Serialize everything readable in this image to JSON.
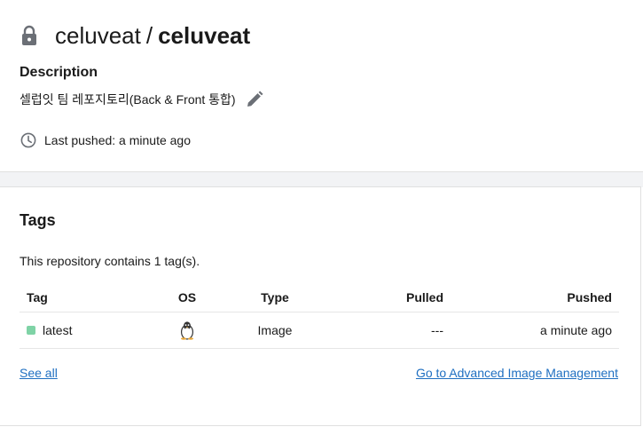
{
  "repo": {
    "namespace": "celuveat",
    "separator": "/",
    "name": "celuveat",
    "lock_icon": "lock-icon"
  },
  "description": {
    "label": "Description",
    "text": "셀럽잇 팀 레포지토리(Back & Front 통합)",
    "edit_icon": "pencil-icon"
  },
  "last_pushed": {
    "icon": "clock-icon",
    "text": "Last pushed: a minute ago"
  },
  "tags": {
    "title": "Tags",
    "count_text": "This repository contains 1 tag(s).",
    "columns": [
      "Tag",
      "OS",
      "Type",
      "Pulled",
      "Pushed"
    ],
    "rows": [
      {
        "tag": "latest",
        "os_icon": "linux-icon",
        "type": "Image",
        "pulled": "---",
        "pushed": "a minute ago",
        "status_color": "#7fd3a6"
      }
    ],
    "see_all": "See all",
    "advanced_link": "Go to Advanced Image Management"
  },
  "colors": {
    "link": "#1f6fc1",
    "icon_gray": "#6b6f76",
    "tag_status": "#7fd3a6"
  }
}
